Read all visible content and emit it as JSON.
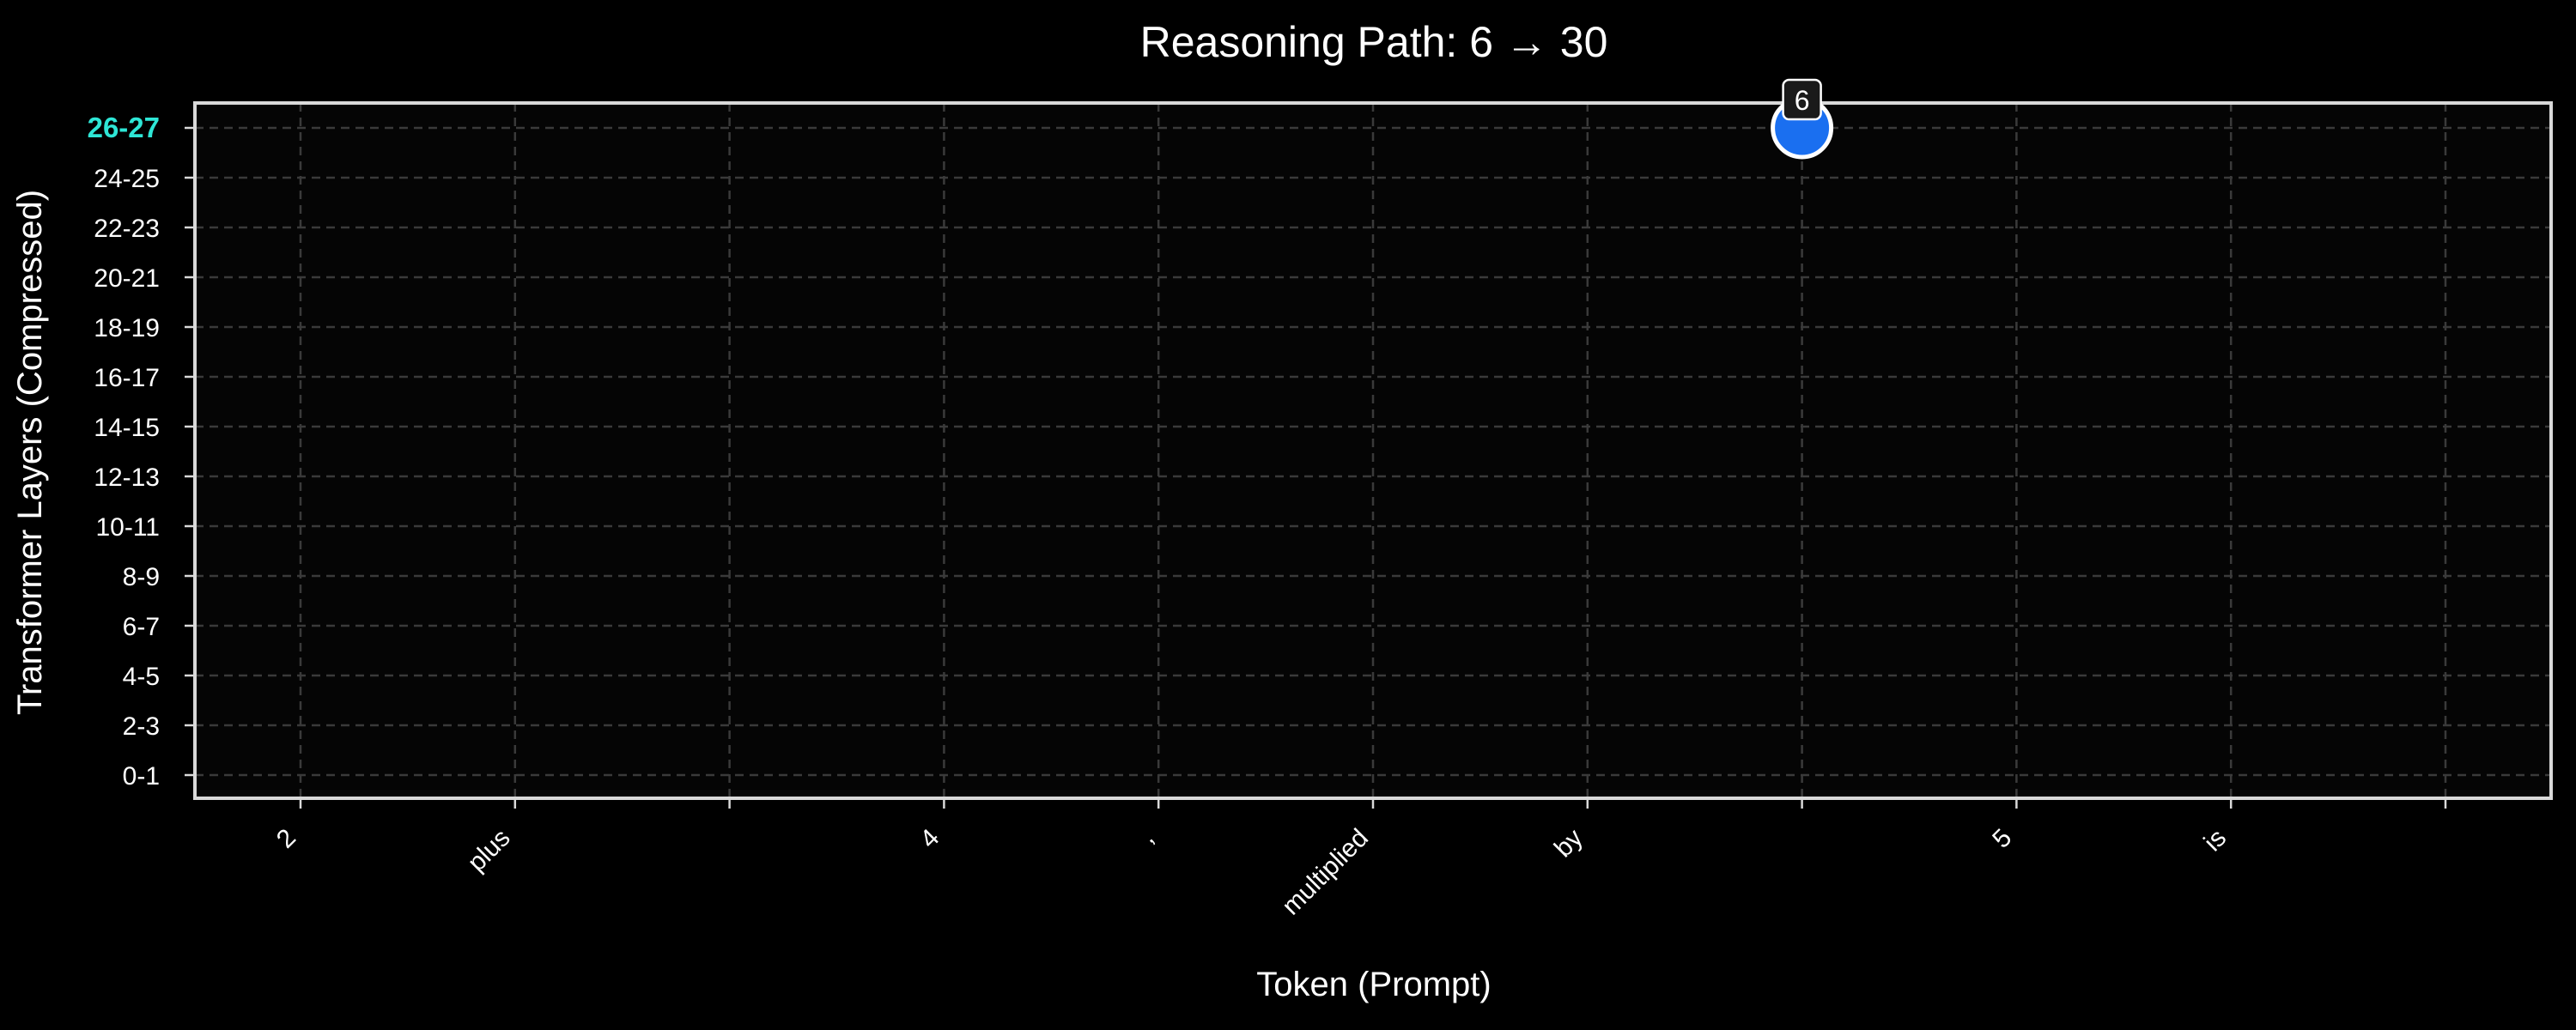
{
  "chart_data": {
    "type": "scatter",
    "title": "Reasoning Path: 6 → 30",
    "xlabel": "Token (Prompt)",
    "ylabel": "Transformer Layers (Compressed)",
    "x_categories": [
      "2",
      "plus",
      "",
      "4",
      ",",
      "multiplied",
      "by",
      "",
      "5",
      "is",
      ""
    ],
    "y_categories": [
      "0-1",
      "2-3",
      "4-5",
      "6-7",
      "8-9",
      "10-11",
      "12-13",
      "14-15",
      "16-17",
      "18-19",
      "20-21",
      "22-23",
      "24-25",
      "26-27"
    ],
    "highlighted_y_category": "26-27",
    "points": [
      {
        "x_index": 7,
        "y_category": "26-27",
        "label": "6"
      }
    ],
    "grid": true,
    "colors": {
      "background": "#000000",
      "plot_background": "#050505",
      "frame": "#d9d9d9",
      "grid": "#3a3a3a",
      "text": "#ffffff",
      "highlight_tick": "#2ee6d6",
      "point_fill": "#1a6ff0",
      "point_stroke": "#ffffff",
      "point_label_bg": "#1a1a1a"
    }
  }
}
